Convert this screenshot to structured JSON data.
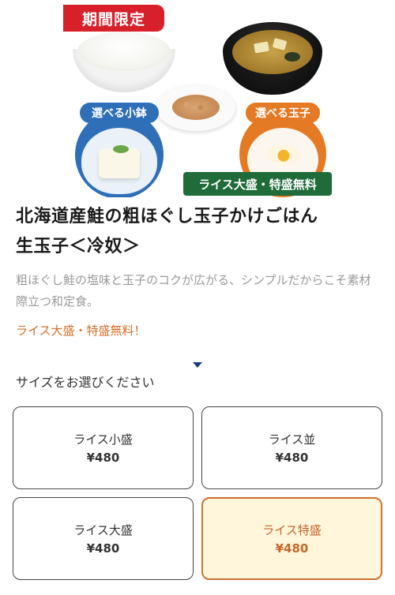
{
  "hero": {
    "limited_badge": "期間限定",
    "left_circle_label": "選べる小鉢",
    "right_circle_label": "選べる玉子",
    "banner": "ライス大盛・特盛無料"
  },
  "product": {
    "title_line1": "北海道産鮭の粗ほぐし玉子かけごはん",
    "title_line2": "生玉子＜冷奴＞",
    "description": "粗ほぐし鮭の塩味と玉子のコクが広がる、シンプルだからこそ素材際立つ和定食。",
    "promo": "ライス大盛・特盛無料！"
  },
  "size_section": {
    "label": "サイズをお選びください",
    "options": [
      {
        "name": "ライス小盛",
        "price": "¥480"
      },
      {
        "name": "ライス並",
        "price": "¥480"
      },
      {
        "name": "ライス大盛",
        "price": "¥480"
      },
      {
        "name": "ライス特盛",
        "price": "¥480"
      }
    ],
    "selected_index": 3
  },
  "colors": {
    "badge_red": "#d8202a",
    "blue": "#2e6fb8",
    "orange": "#e57a25",
    "banner_green": "#1f6b3a",
    "selected_border": "#d0722e"
  }
}
